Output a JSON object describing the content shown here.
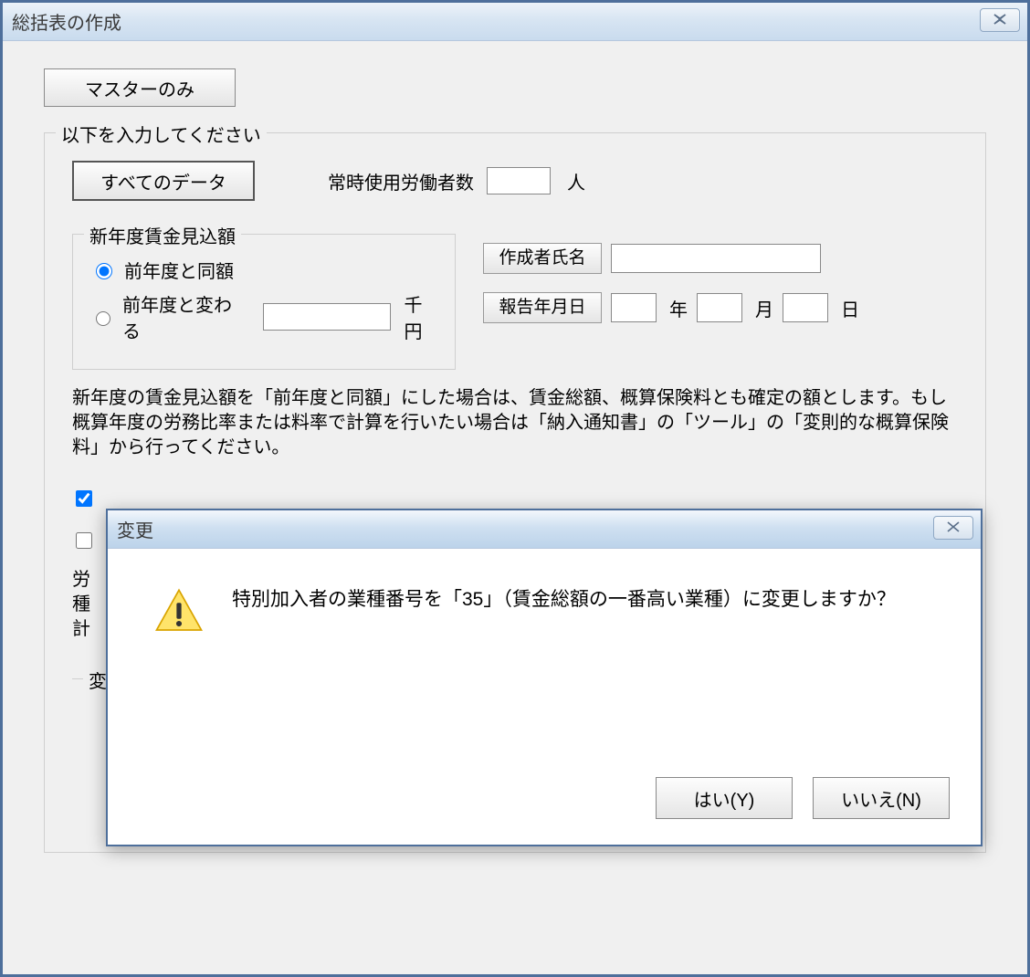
{
  "window": {
    "title": "総括表の作成"
  },
  "buttons": {
    "master_only": "マスターのみ",
    "all_data": "すべてのデータ"
  },
  "fieldset": {
    "legend": "以下を入力してください",
    "workers_label": "常時使用労働者数",
    "workers_value": "",
    "workers_unit": "人"
  },
  "wage_forecast": {
    "legend": "新年度賃金見込額",
    "radio_same": "前年度と同額",
    "radio_change": "前年度と変わる",
    "change_value": "",
    "change_unit": "千円",
    "selected": "same"
  },
  "right": {
    "creator_label": "作成者氏名",
    "creator_value": "",
    "report_date_label": "報告年月日",
    "year_value": "",
    "year_unit": "年",
    "month_value": "",
    "month_unit": "月",
    "day_value": "",
    "day_unit": "日"
  },
  "note": "新年度の賃金見込額を「前年度と同額」にした場合は、賃金総額、概算保険料とも確定の額とします。もし概算年度の労務比率または料率で計算を行いたい場合は「納入通知書」の「ツール」の「変則的な概算保険料」から行ってください。",
  "checkbox1_checked": true,
  "partial_label_1": "労",
  "partial_label_2": "種",
  "partial_label_3": "計",
  "partial_label_4": "変",
  "dialog": {
    "title": "変更",
    "message": "特別加入者の業種番号を「35」（賃金総額の一番高い業種）に変更しますか？",
    "yes": "はい(Y)",
    "no": "いいえ(N)"
  }
}
